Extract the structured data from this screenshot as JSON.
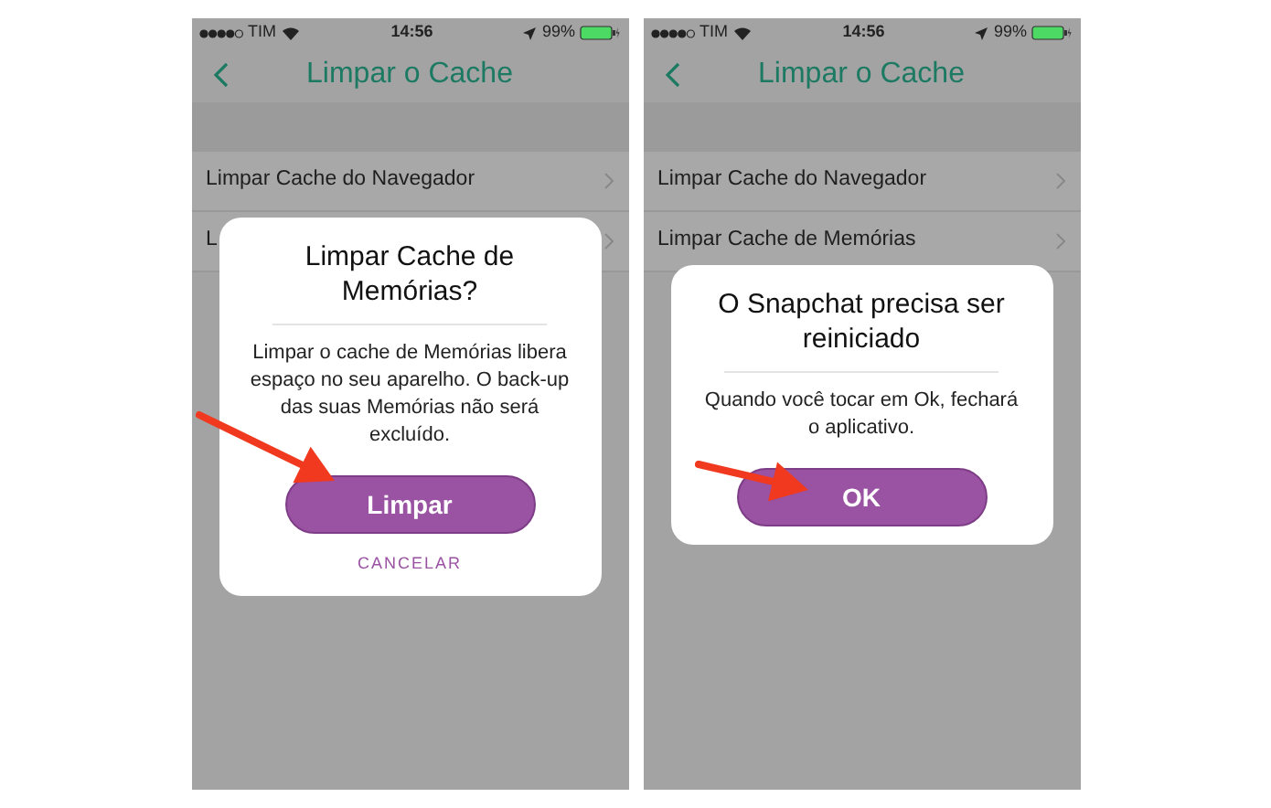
{
  "screens": [
    {
      "status_bar": {
        "carrier": "TIM",
        "time": "14:56",
        "battery": "99%"
      },
      "nav": {
        "title": "Limpar o Cache"
      },
      "rows": [
        {
          "label": "Limpar Cache do Navegador"
        },
        {
          "label": "L"
        }
      ],
      "dialog": {
        "title": "Limpar Cache de Memórias?",
        "message": "Limpar o cache de Memórias libera espaço no seu aparelho. O back-up das suas Memórias não será excluído.",
        "primary_button": "Limpar",
        "secondary_button": "CANCELAR"
      }
    },
    {
      "status_bar": {
        "carrier": "TIM",
        "time": "14:56",
        "battery": "99%"
      },
      "nav": {
        "title": "Limpar o Cache"
      },
      "rows": [
        {
          "label": "Limpar Cache do Navegador"
        },
        {
          "label": "Limpar Cache de Memórias"
        }
      ],
      "dialog": {
        "title": "O Snapchat precisa ser reiniciado",
        "message": "Quando você tocar em Ok, fechará o aplicativo.",
        "primary_button": "OK"
      }
    }
  ]
}
